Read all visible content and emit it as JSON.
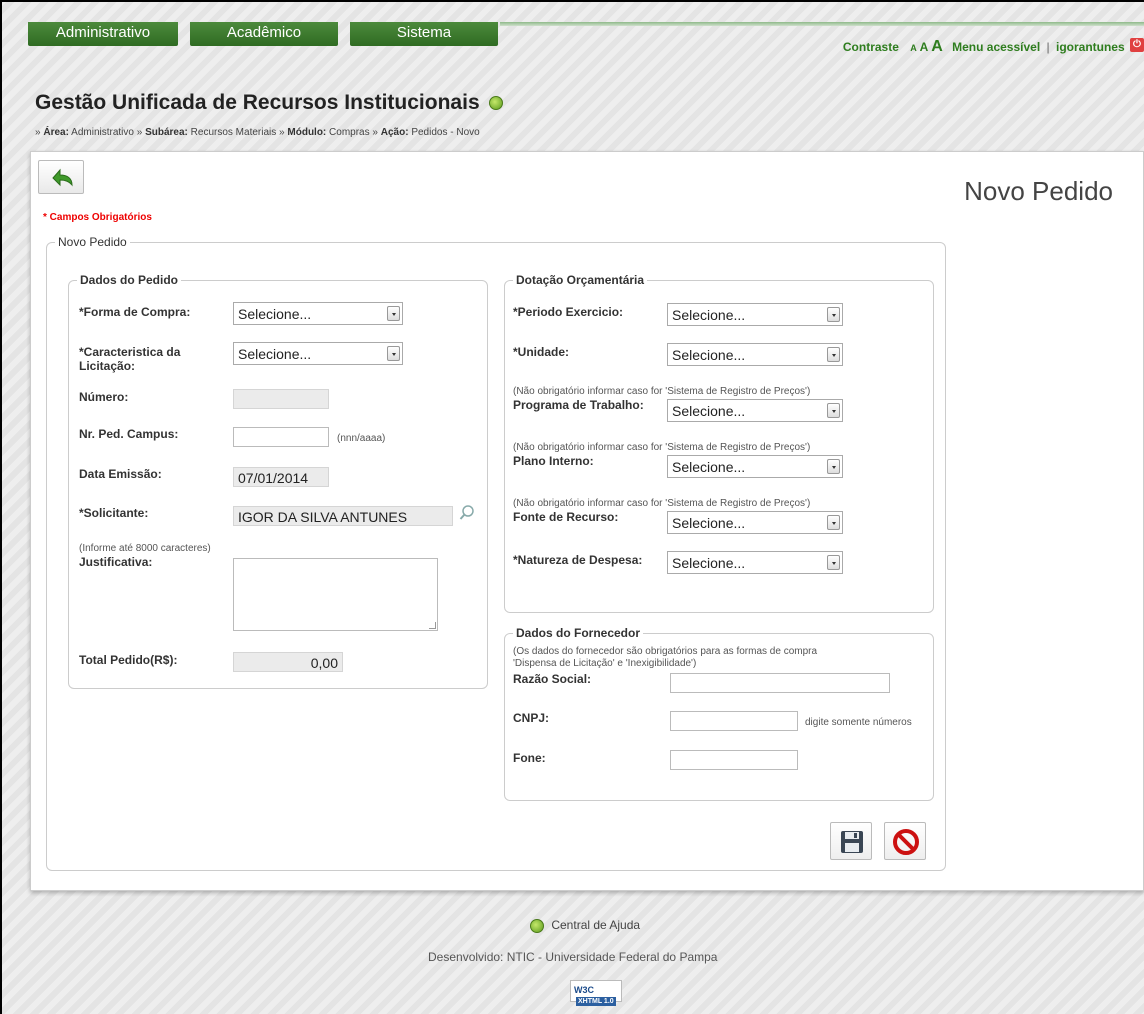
{
  "topnav": {
    "tabs": [
      "Administrativo",
      "Acadêmico",
      "Sistema"
    ]
  },
  "toplinks": {
    "contraste": "Contraste",
    "a_small": "A",
    "a_medium": "A",
    "a_large": "A",
    "menu_acessivel": "Menu acessível",
    "separator": "|",
    "user": "igorantunes"
  },
  "header": {
    "app_title": "Gestão Unificada de Recursos Institucionais",
    "breadcrumb": {
      "prefix": "»",
      "area_label": "Área:",
      "area": "Administrativo",
      "sep": "»",
      "subarea_label": "Subárea:",
      "subarea": "Recursos Materiais",
      "modulo_label": "Módulo:",
      "modulo": "Compras",
      "acao_label": "Ação:",
      "acao": "Pedidos - Novo"
    }
  },
  "page": {
    "title": "Novo Pedido",
    "required_note": "* Campos Obrigatórios",
    "main_legend": "Novo Pedido"
  },
  "dados_pedido": {
    "legend": "Dados do Pedido",
    "forma_compra_label": "*Forma de Compra:",
    "forma_compra_value": "Selecione...",
    "caracteristica_label_1": "*Caracteristica da",
    "caracteristica_label_2": "Licitação:",
    "caracteristica_value": "Selecione...",
    "numero_label": "Número:",
    "numero_value": "",
    "nr_ped_label": "Nr. Ped. Campus:",
    "nr_ped_value": "",
    "nr_ped_hint": "(nnn/aaaa)",
    "data_emissao_label": "Data Emissão:",
    "data_emissao_value": "07/01/2014",
    "solicitante_label": "*Solicitante:",
    "solicitante_value": "IGOR DA SILVA ANTUNES",
    "justificativa_note": "(Informe até 8000 caracteres)",
    "justificativa_label": "Justificativa:",
    "total_label": "Total Pedido(R$):",
    "total_value": "0,00"
  },
  "dotacao": {
    "legend": "Dotação Orçamentária",
    "periodo_label": "*Periodo Exercicio:",
    "periodo_value": "Selecione...",
    "unidade_label": "*Unidade:",
    "unidade_value": "Selecione...",
    "nao_obrig_note": "(Não obrigatório informar caso for 'Sistema de Registro de Preços')",
    "programa_label": "Programa de Trabalho:",
    "programa_value": "Selecione...",
    "plano_label": "Plano Interno:",
    "plano_value": "Selecione...",
    "fonte_label": "Fonte de Recurso:",
    "fonte_value": "Selecione...",
    "natureza_label": "*Natureza de Despesa:",
    "natureza_value": "Selecione..."
  },
  "fornecedor": {
    "legend": "Dados do Fornecedor",
    "note_1": "(Os dados do fornecedor são obrigatórios para as formas de compra",
    "note_2": "'Dispensa de Licitação' e 'Inexigibilidade')",
    "razao_label": "Razão Social:",
    "razao_value": "",
    "cnpj_label": "CNPJ:",
    "cnpj_value": "",
    "cnpj_hint": "digite somente números",
    "fone_label": "Fone:",
    "fone_value": ""
  },
  "footer": {
    "help": "Central de Ajuda",
    "developed": "Desenvolvido: NTIC - Universidade Federal do Pampa",
    "w3c": "W3C",
    "xhtml": "XHTML 1.0"
  },
  "colors": {
    "nav_green": "#2f6b22",
    "link_green": "#2e7d1e",
    "required_red": "#e00000",
    "cancel_red": "#cc1111"
  },
  "icons": {
    "back": "undo-arrow-icon",
    "help": "help-icon",
    "search": "search-icon",
    "save": "floppy-disk-icon",
    "cancel": "prohibited-icon",
    "logout": "power-icon"
  }
}
